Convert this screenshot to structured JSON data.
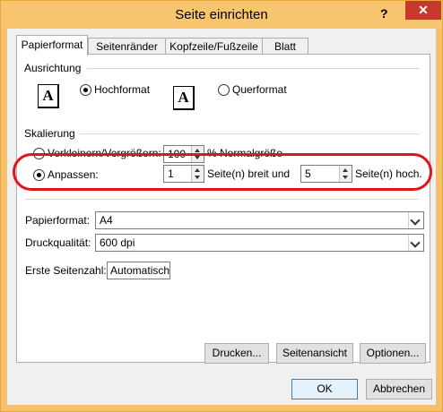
{
  "window": {
    "title": "Seite einrichten",
    "help": "?",
    "close": "✕"
  },
  "tabs": [
    "Papierformat",
    "Seitenränder",
    "Kopfzeile/Fußzeile",
    "Blatt"
  ],
  "orientation": {
    "heading": "Ausrichtung",
    "portrait_label": "Hochformat",
    "landscape_label": "Querformat",
    "icon_letter": "A",
    "selected": "portrait"
  },
  "scaling": {
    "heading": "Skalierung",
    "adjust_label": "Verkleinern/Vergrößern:",
    "adjust_value": "100",
    "adjust_suffix": "% Normalgröße",
    "fit_label": "Anpassen:",
    "fit_wide_value": "1",
    "fit_wide_suffix": "Seite(n) breit und",
    "fit_tall_value": "5",
    "fit_tall_suffix": "Seite(n) hoch.",
    "selected": "fit"
  },
  "paper": {
    "size_label": "Papierformat:",
    "size_value": "A4",
    "quality_label": "Druckqualität:",
    "quality_value": "600 dpi",
    "first_page_label": "Erste Seitenzahl:",
    "first_page_value": "Automatisch"
  },
  "buttons": {
    "print": "Drucken...",
    "preview": "Seitenansicht",
    "options": "Optionen...",
    "ok": "OK",
    "cancel": "Abbrechen"
  },
  "colors": {
    "titlebar": "#f7c46f",
    "close": "#c7382d",
    "highlight": "#e0141a"
  }
}
